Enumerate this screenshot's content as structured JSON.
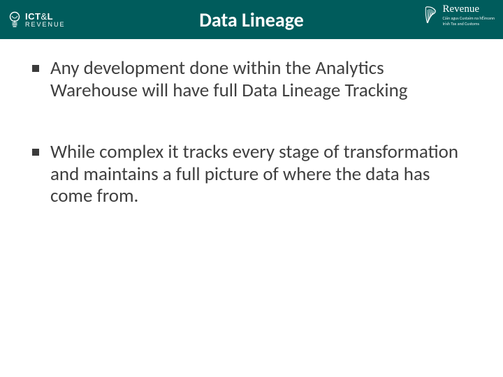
{
  "header": {
    "title": "Data Lineage",
    "logo_left": {
      "line1_a": "ICT",
      "line1_amp": "&",
      "line1_b": "L",
      "line2": "REVENUE"
    },
    "logo_right": {
      "main": "Revenue",
      "sub1": "Cáin agus Custaim na hÉireann",
      "sub2": "Irish Tax and Customs"
    }
  },
  "bullets": [
    "Any development done within the Analytics Warehouse will have full Data Lineage Tracking",
    "While complex it tracks every stage of transformation and maintains a full picture of where the data has come from."
  ]
}
